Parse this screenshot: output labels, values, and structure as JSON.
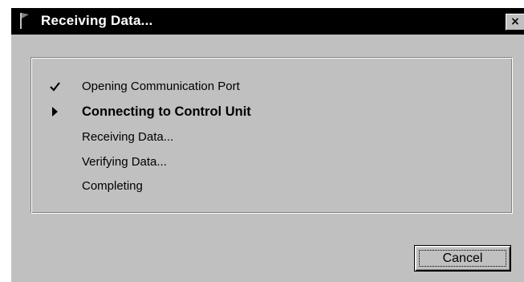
{
  "window": {
    "title": "Receiving Data...",
    "close_label": "×"
  },
  "steps": [
    {
      "label": "Opening Communication Port",
      "status": "done"
    },
    {
      "label": "Connecting to Control Unit",
      "status": "active"
    },
    {
      "label": "Receiving Data...",
      "status": "pending"
    },
    {
      "label": "Verifying Data...",
      "status": "pending"
    },
    {
      "label": "Completing",
      "status": "pending"
    }
  ],
  "buttons": {
    "cancel_label": "Cancel"
  },
  "colors": {
    "titlebar": "#000000",
    "face": "#c0c0c0"
  },
  "icons": {
    "window": "flag-icon",
    "close": "close-icon",
    "done": "checkmark-icon",
    "active": "arrow-right-icon"
  }
}
